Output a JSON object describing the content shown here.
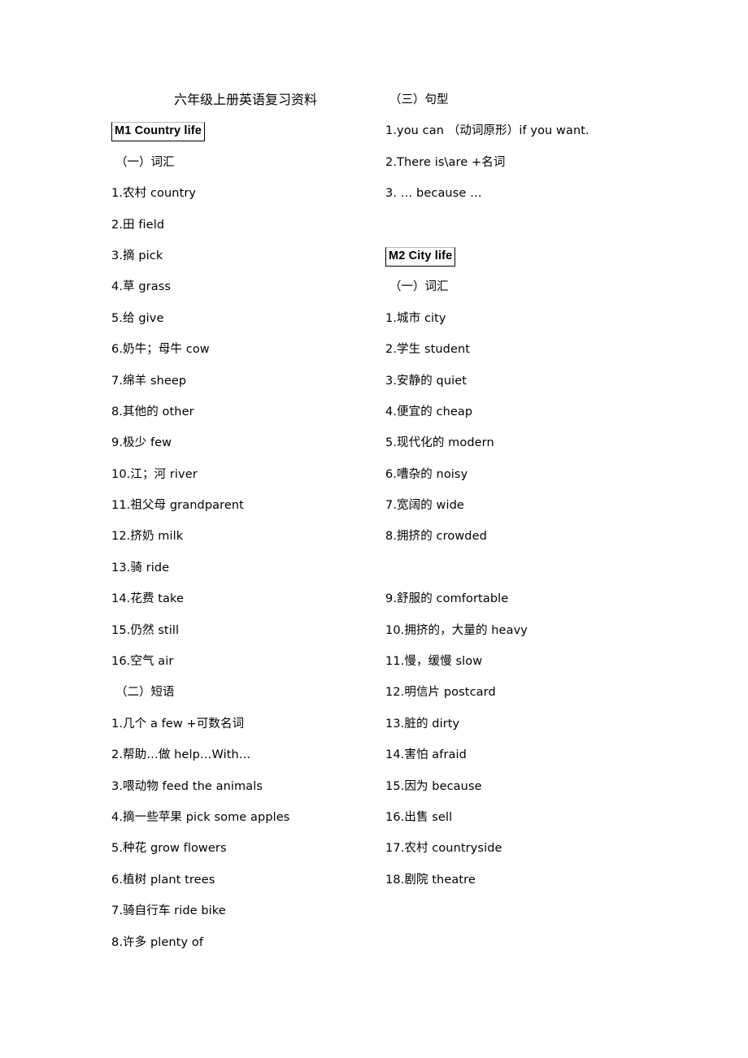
{
  "document": {
    "title": "六年级上册英语复习资料"
  },
  "left_column": {
    "module": {
      "label": "M1 Country life"
    },
    "vocab_section": {
      "heading": "（一）词汇",
      "items": [
        "1.农村 country",
        "2.田  field",
        "3.摘  pick",
        "4.草  grass",
        "5.给  give",
        "6.奶牛；母牛  cow",
        "7.绵羊  sheep",
        "8.其他的  other",
        "9.极少  few",
        "10.江；河  river",
        "11.祖父母  grandparent",
        "12.挤奶  milk",
        "13.骑  ride",
        "14.花费  take",
        "15.仍然  still",
        "16.空气  air"
      ]
    },
    "phrase_section": {
      "heading": "（二）短语",
      "items": [
        "1.几个  a few +可数名词",
        "2.帮助…做  help…With…",
        "3.喂动物  feed the animals",
        "4.摘一些苹果  pick some apples",
        "5.种花  grow flowers",
        "6.植树  plant trees",
        "7.骑自行车  ride bike",
        "8.许多  plenty of"
      ]
    }
  },
  "right_column": {
    "sentence_section": {
      "heading": "（三）句型",
      "items": [
        "1.you can  （动词原形）if you want.",
        "2.There is\\are +名词",
        "3. …  because  …"
      ]
    },
    "module": {
      "label": "M2 City life"
    },
    "vocab_section": {
      "heading": "（一）词汇",
      "items_part1": [
        "1.城市  city",
        "2.学生  student",
        "3.安静的  quiet",
        "4.便宜的  cheap",
        "5.现代化的  modern",
        "6.嘈杂的  noisy",
        "7.宽阔的  wide",
        "8.拥挤的  crowded"
      ],
      "items_part2": [
        "9.舒服的   comfortable",
        "10.拥挤的，大量的  heavy",
        "11.慢，缓慢  slow",
        "12.明信片  postcard",
        "13.脏的  dirty",
        "14.害怕  afraid",
        "15.因为  because",
        "16.出售  sell",
        "17.农村  countryside",
        "18.剧院  theatre"
      ]
    }
  }
}
